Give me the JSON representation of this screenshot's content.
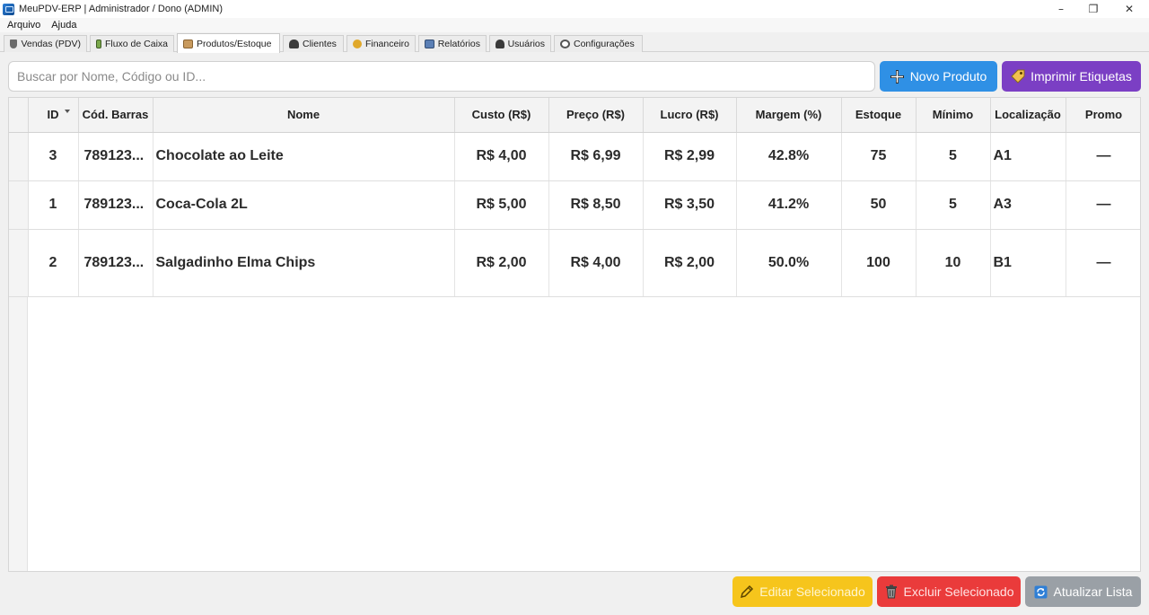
{
  "window": {
    "title": "MeuPDV-ERP  |  Administrador / Dono (ADMIN)",
    "controls": [
      "minimize-icon",
      "restore-icon",
      "close-icon"
    ]
  },
  "menu": {
    "items": [
      "Arquivo",
      "Ajuda"
    ]
  },
  "tabs": [
    {
      "label": "Vendas (PDV)",
      "icon": "cart-icon"
    },
    {
      "label": "Fluxo de Caixa",
      "icon": "cash-icon"
    },
    {
      "label": "Produtos/Estoque",
      "icon": "box-icon",
      "active": true
    },
    {
      "label": "Clientes",
      "icon": "people-icon"
    },
    {
      "label": "Financeiro",
      "icon": "money-bag-icon"
    },
    {
      "label": "Relatórios",
      "icon": "bar-chart-icon"
    },
    {
      "label": "Usuários",
      "icon": "user-icon"
    },
    {
      "label": "Configurações",
      "icon": "gear-icon"
    }
  ],
  "search": {
    "placeholder": "Buscar por Nome, Código ou ID...",
    "value": ""
  },
  "toolbar": {
    "new_product_label": "Novo Produto",
    "print_labels_label": "Imprimir Etiquetas"
  },
  "table": {
    "columns": [
      "ID",
      "Cód. Barras",
      "Nome",
      "Custo (R$)",
      "Preço (R$)",
      "Lucro (R$)",
      "Margem (%)",
      "Estoque",
      "Mínimo",
      "Localização",
      "Promo"
    ],
    "sorted_column": "ID",
    "rows": [
      {
        "id": "3",
        "barcode": "789123...",
        "name": "Chocolate ao Leite",
        "cost": "R$ 4,00",
        "price": "R$ 6,99",
        "profit": "R$ 2,99",
        "margin": "42.8%",
        "stock": "75",
        "min": "5",
        "location": "A1",
        "promo": "—"
      },
      {
        "id": "1",
        "barcode": "789123...",
        "name": "Coca-Cola 2L",
        "cost": "R$ 5,00",
        "price": "R$ 8,50",
        "profit": "R$ 3,50",
        "margin": "41.2%",
        "stock": "50",
        "min": "5",
        "location": "A3",
        "promo": "—"
      },
      {
        "id": "2",
        "barcode": "789123...",
        "name": "Salgadinho Elma Chips",
        "cost": "R$ 2,00",
        "price": "R$ 4,00",
        "profit": "R$ 2,00",
        "margin": "50.0%",
        "stock": "100",
        "min": "10",
        "location": "B1",
        "promo": "—"
      }
    ]
  },
  "footer": {
    "edit_label": "Editar Selecionado",
    "delete_label": "Excluir Selecionado",
    "refresh_label": "Atualizar Lista"
  },
  "colors": {
    "new_product": "#2f90e5",
    "print_labels": "#7b3fc4",
    "edit": "#f6c51c",
    "delete": "#ea3b3b",
    "refresh": "#9aa0a6"
  }
}
